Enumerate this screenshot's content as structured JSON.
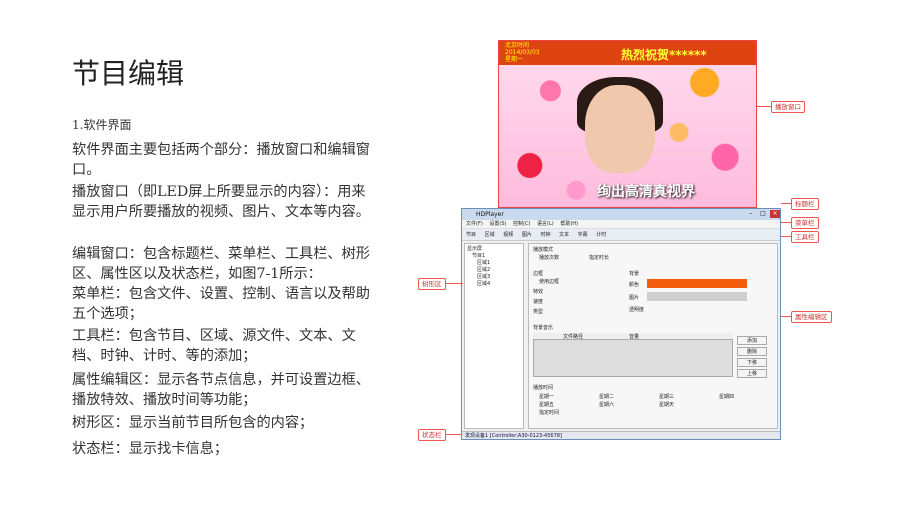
{
  "slide": {
    "title": "节目编辑",
    "subtitle": "1.软件界面",
    "paragraphs": [
      "软件界面主要包括两个部分：播放窗口和编辑窗口。",
      "播放窗口（即LED屏上所要显示的内容）：用来显示用户所要播放的视频、图片、文本等内容。",
      "编辑窗口：包含标题栏、菜单栏、工具栏、树形区、属性区以及状态栏，如图7-1所示：",
      "菜单栏：包含文件、设置、控制、语言以及帮助五个选项；",
      "工具栏：包含节目、区域、源文件、文本、文档、时钟、计时、等的添加；",
      "属性编辑区：显示各节点信息，并可设置边框、播放特效、播放时间等功能；",
      "树形区：显示当前节目所包含的内容；",
      "状态栏：显示找卡信息；"
    ]
  },
  "playback": {
    "top_left_lines": [
      "北京时间",
      "2014/03/03",
      "星期一"
    ],
    "scroll_text": "热烈祝贺******",
    "banner": "绚出高清真视界"
  },
  "app": {
    "title": "HDPlayer",
    "menu": [
      "文件(F)",
      "设置(S)",
      "控制(C)",
      "语言(L)",
      "帮助(H)"
    ],
    "toolbar": [
      "节目",
      "区域",
      "视频",
      "图片",
      "时钟",
      "文本",
      "字幕",
      "计时"
    ],
    "tree": [
      "显示屏",
      "节目1",
      "区域1",
      "区域2",
      "区域3",
      "区域4"
    ],
    "props": {
      "section_play": "播放模式",
      "play_count": "播放次数",
      "play_fixed": "指定时长",
      "border": "边框",
      "use_border": "使用边框",
      "effect": "特效",
      "speed": "速度",
      "type": "类型",
      "background": "背景",
      "color": "颜色",
      "image": "图片",
      "opacity": "透明度",
      "bg_music": "背景音乐",
      "col_path": "文件路径",
      "col_volume": "音量",
      "btn_add": "添加",
      "btn_del": "删除",
      "btn_down": "下移",
      "btn_up": "上移",
      "play_time": "播放时间",
      "days": [
        "星期一",
        "星期二",
        "星期三",
        "星期四",
        "星期五",
        "星期六",
        "星期天"
      ],
      "fixed_time": "指定时间"
    },
    "status": "发现设备1 [Controller:A30-0123-45678]"
  },
  "callouts": {
    "play_window": "播放窗口",
    "title_bar": "标题栏",
    "menu_bar": "菜单栏",
    "tool_bar": "工具栏",
    "tree_area": "树形区",
    "prop_area": "属性编辑区",
    "status_bar": "状态栏"
  },
  "colors": {
    "callout": "#e55555",
    "accent_orange": "#f25c0a"
  }
}
